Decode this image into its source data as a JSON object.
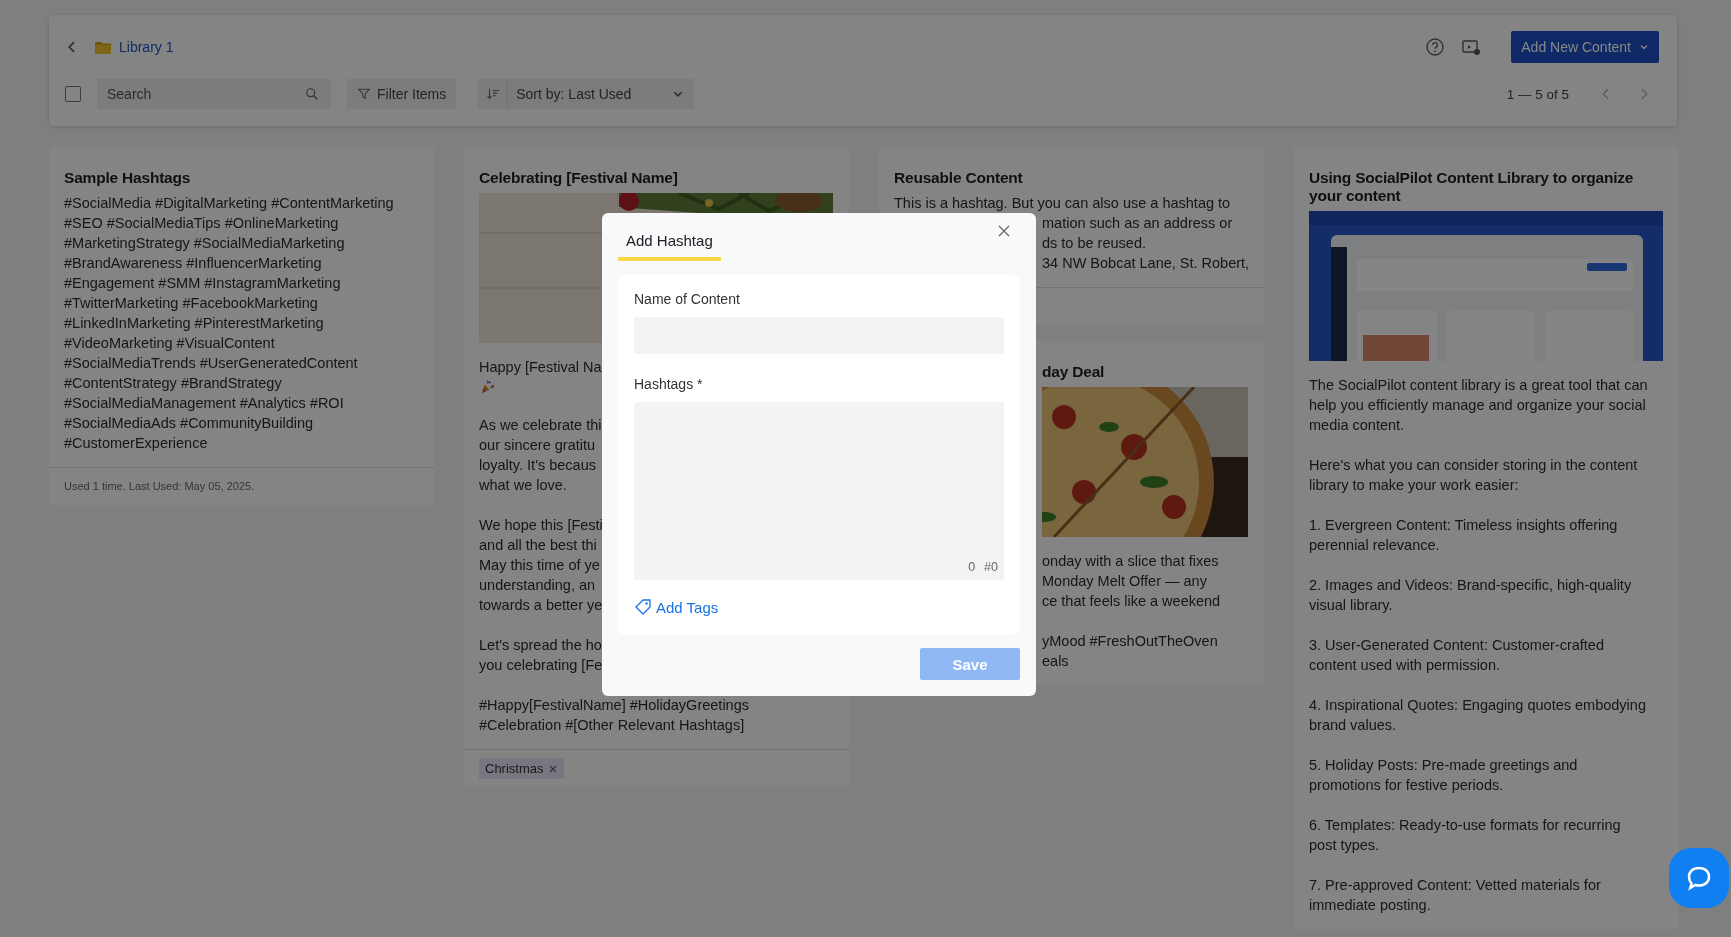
{
  "header": {
    "library": "Library 1",
    "add_button": "Add New Content"
  },
  "toolbar": {
    "select_all": {
      "checked": false
    },
    "search": {
      "placeholder": "Search"
    },
    "filter": "Filter Items",
    "sort": "Sort by: Last Used",
    "pagination": {
      "label": "1 — 5 of 5",
      "prev_disabled": true,
      "next_disabled": true
    }
  },
  "columns": [
    [
      {
        "title": "Sample Hashtags",
        "title_covered": false,
        "divider": true,
        "footer": "Used 1 time. Last Used: May 05, 2025.",
        "body": [
          {
            "kind": "para",
            "lines": [
              "#SocialMedia #DigitalMarketing #ContentMarketing",
              "#SEO #SocialMediaTips #OnlineMarketing",
              "#MarketingStrategy #SocialMediaMarketing",
              "#BrandAwareness #InfluencerMarketing",
              "#Engagement #SMM #InstagramMarketing",
              "#TwitterMarketing #FacebookMarketing",
              "#LinkedInMarketing #PinterestMarketing",
              "#VideoMarketing #VisualContent",
              "#SocialMediaTrends #UserGeneratedContent",
              "#ContentStrategy #BrandStrategy",
              "#SocialMediaManagement #Analytics #ROI",
              "#SocialMediaAds #CommunityBuilding",
              "#CustomerExperience"
            ]
          }
        ]
      }
    ],
    [
      {
        "title": "Celebrating [Festival Name]",
        "title_covered": false,
        "divider": true,
        "media": {
          "kind": "picture"
        },
        "tags": [
          {
            "label": "Christmas"
          }
        ],
        "body": [
          {
            "kind": "para",
            "lines": [
              "Happy [Festival Na"
            ]
          },
          {
            "kind": "emoji"
          },
          {
            "kind": "para",
            "lines": [
              "As we celebrate thi",
              "our sincere gratitu",
              "loyalty. It's becaus",
              "what we love."
            ]
          },
          {
            "kind": "para",
            "lines": [
              "We hope this [Festi",
              "and all the best thi",
              "May this time of ye",
              "understanding, an",
              "towards a better ye"
            ]
          },
          {
            "kind": "para",
            "lines": [
              "Let's spread the ho",
              "you celebrating [Fe"
            ]
          },
          {
            "kind": "para",
            "lines": [
              "#Happy[FestivalName] #HolidayGreetings",
              "#Celebration #[Other Relevant Hashtags]"
            ]
          }
        ]
      }
    ],
    [
      {
        "title": "Reusable Content",
        "title_covered": false,
        "divider": true,
        "body": [
          {
            "kind": "cut",
            "lead": "This is a hashtag. But you can also use a hashtag to",
            "lines": [
              "mation such as an address or",
              "ds to be reused.",
              "34 NW Bobcat Lane, St. Robert,"
            ]
          }
        ]
      },
      {
        "title": "day Deal",
        "title_covered": true,
        "divider": false,
        "media": {
          "kind": "picture"
        },
        "body": [
          {
            "kind": "cut",
            "lines": [
              "onday with a slice that fixes",
              "Monday Melt Offer — any",
              "ce that feels like a weekend"
            ]
          },
          {
            "kind": "cut",
            "lines": [
              "yMood #FreshOutTheOven",
              "eals"
            ]
          }
        ]
      }
    ],
    [
      {
        "title": "Using SocialPilot Content Library to organize your content",
        "title_covered": false,
        "divider": false,
        "media": {
          "kind": "picture"
        },
        "body": [
          {
            "kind": "para",
            "lines": [
              "The SocialPilot content library is a great tool that can",
              "help you efficiently manage and organize your social",
              "media content."
            ]
          },
          {
            "kind": "para",
            "lines": [
              "Here's what you can consider storing in the content",
              "library to make your work easier:"
            ]
          },
          {
            "kind": "para",
            "lines": [
              "1. Evergreen Content: Timeless insights offering",
              "perennial relevance."
            ]
          },
          {
            "kind": "para",
            "lines": [
              "2. Images and Videos: Brand-specific, high-quality",
              "visual library."
            ]
          },
          {
            "kind": "para",
            "lines": [
              "3. User-Generated Content: Customer-crafted",
              "content used with permission."
            ]
          },
          {
            "kind": "para",
            "lines": [
              "4. Inspirational Quotes: Engaging quotes embodying",
              "brand values."
            ]
          },
          {
            "kind": "para",
            "lines": [
              "5. Holiday Posts: Pre-made greetings and",
              "promotions for festive periods."
            ]
          },
          {
            "kind": "para",
            "lines": [
              "6. Templates: Ready-to-use formats for recurring",
              "post types."
            ]
          },
          {
            "kind": "para",
            "lines": [
              "7. Pre-approved Content: Vetted materials for",
              "immediate posting."
            ]
          }
        ]
      }
    ]
  ],
  "modal": {
    "tabs": [
      {
        "label": "Add Hashtag",
        "selected": true
      }
    ],
    "name_label": "Name of Content",
    "hashtags_label": "Hashtags *",
    "char_count": "0",
    "hashtag_count": "#0",
    "add_tags": "Add Tags",
    "save": {
      "label": "Save",
      "disabled": true
    }
  }
}
